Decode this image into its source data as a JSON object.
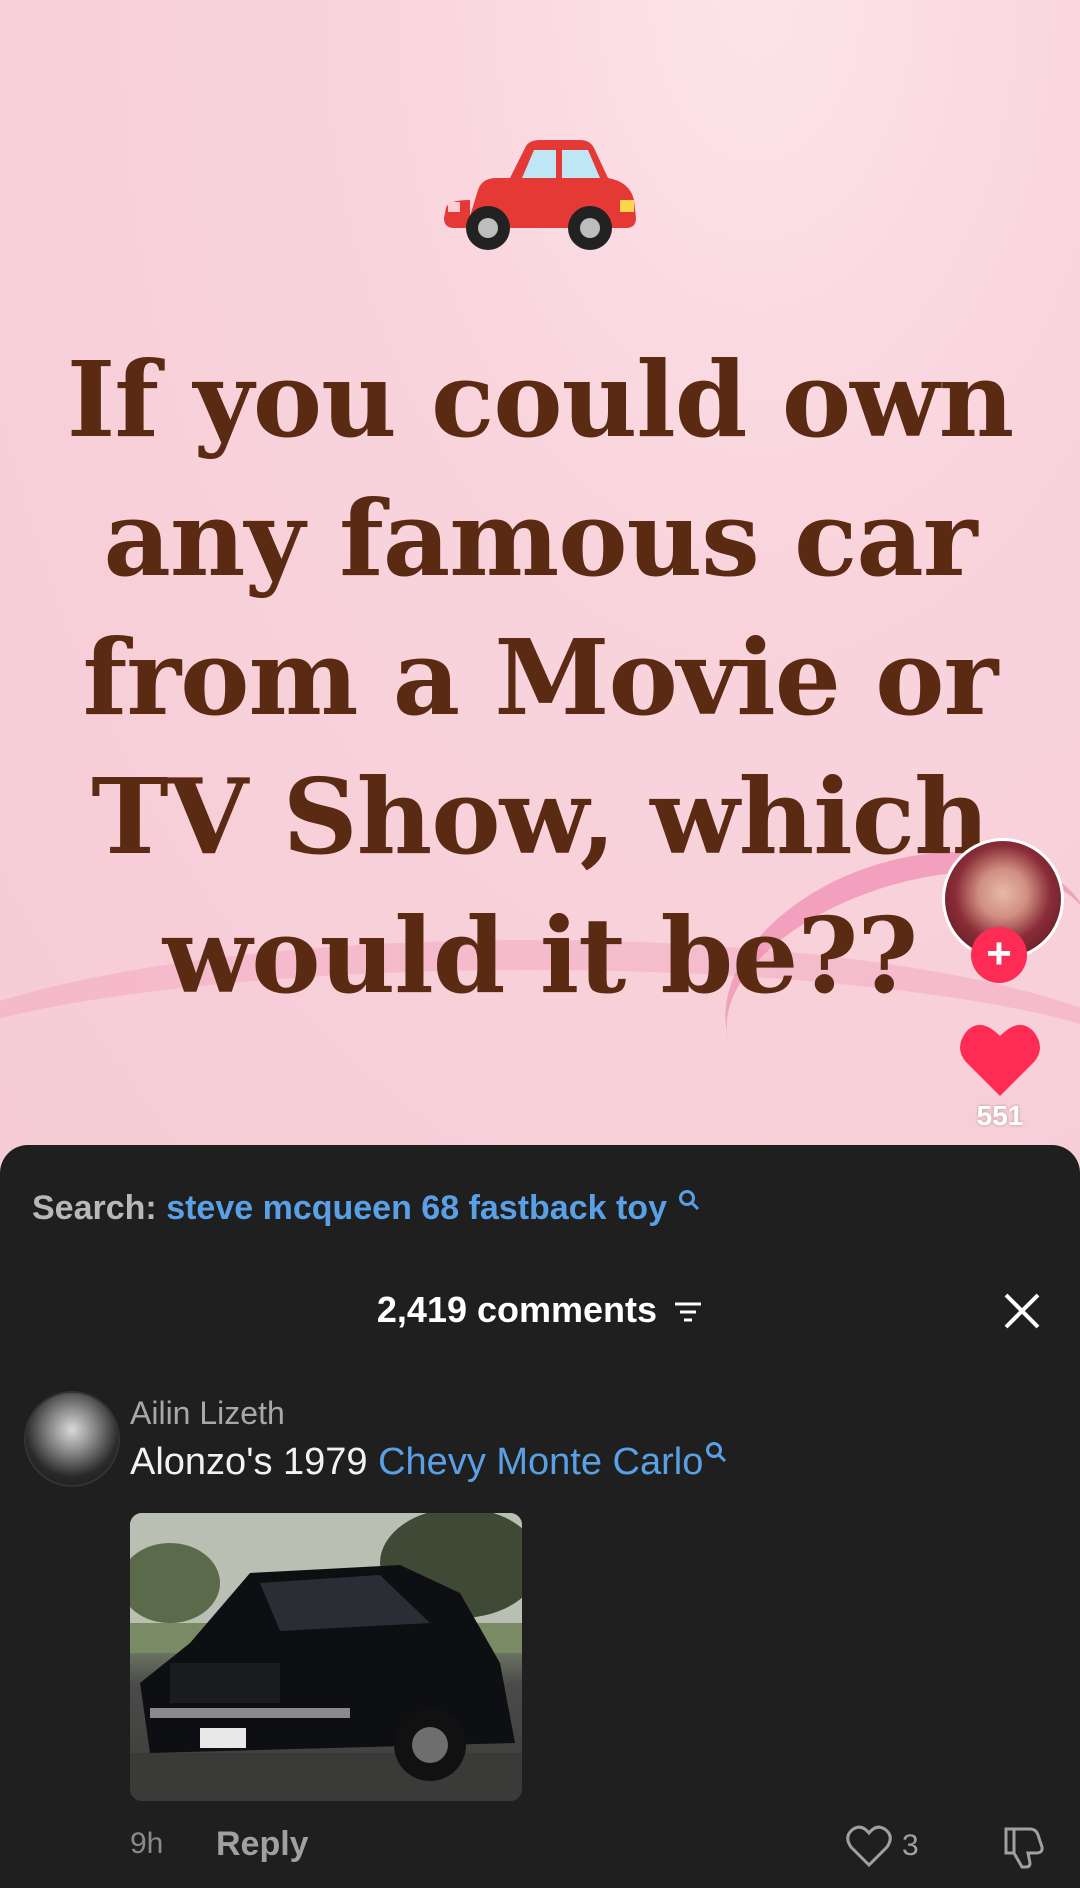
{
  "video": {
    "headline": "If you could own any famous car from a Movie or TV Show, which would it be??",
    "like_count": "551"
  },
  "search": {
    "label": "Search:",
    "term": "steve mcqueen 68 fastback toy"
  },
  "comments": {
    "header": "2,419 comments",
    "items": [
      {
        "author": "Ailin Lizeth",
        "text_prefix": "Alonzo's 1979 ",
        "text_link": "Chevy Monte Carlo",
        "time": "9h",
        "reply_label": "Reply",
        "like_count": "3"
      }
    ]
  },
  "colors": {
    "accent_red": "#fe2c55",
    "link_blue": "#5aa0e6",
    "headline_brown": "#5a2a12",
    "sheet_bg": "#1f1f1f"
  },
  "icons": [
    "car-icon",
    "follow-plus-icon",
    "heart-icon",
    "search-magnifier-icon",
    "sort-icon",
    "close-icon",
    "comment-like-icon",
    "dislike-icon"
  ]
}
